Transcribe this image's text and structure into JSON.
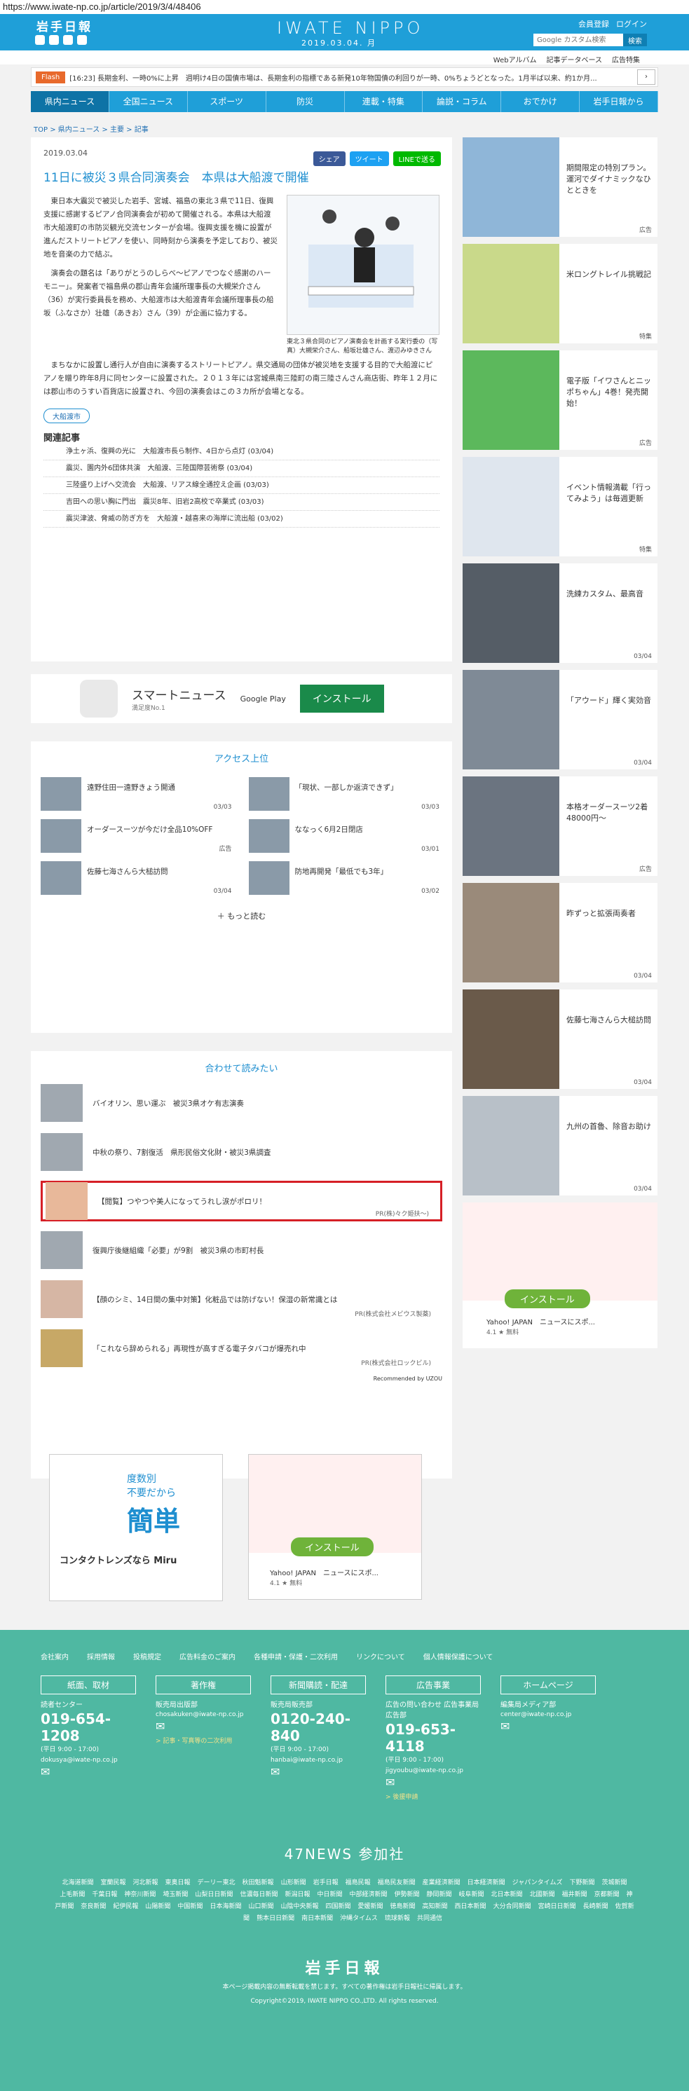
{
  "url": "https://www.iwate-np.co.jp/article/2019/3/4/48406",
  "header": {
    "logo": "岩手日報",
    "brand": "IWATE NIPPO",
    "date": "2019.03.04. 月",
    "links": [
      "会員登録",
      "ログイン"
    ],
    "search_placeholder": "Google カスタム検索",
    "search_button": "検索"
  },
  "subnav": [
    "Webアルバム",
    "記事データベース",
    "広告特集"
  ],
  "flash": {
    "tag": "Flash",
    "text": "[16:23] 長期金利、一時0%に上昇　週明け4日の国債市場は、長期金利の指標である新発10年物国債の利回りが一時、0%ちょうどとなった。1月半ば以来、約1か月..."
  },
  "gnav": [
    "県内ニュース",
    "全国ニュース",
    "スポーツ",
    "防災",
    "連載・特集",
    "論説・コラム",
    "おでかけ",
    "岩手日報から"
  ],
  "crumb": "TOP > 県内ニュース > 主要 > 記事",
  "article": {
    "date": "2019.03.04",
    "share": [
      "シェア",
      "ツイート",
      "LINEで送る"
    ],
    "title": "11日に被災３県合同演奏会　本県は大船渡で開催",
    "p1": "東日本大震災で被災した岩手、宮城、福島の東北３県で11日、復興支援に感謝するピアノ合同演奏会が初めて開催される。本県は大船渡市大船渡町の市防災観光交流センターが会場。復興支援を機に設置が進んだストリートピアノを使い、同時刻から演奏を予定しており、被災地を音楽の力で結ぶ。",
    "p2": "演奏会の題名は「ありがとうのしらべ〜ピアノでつなぐ感謝のハーモニー」。発案者で福島県の郡山青年会議所理事長の大槻栄介さん（36）が実行委員長を務め、大船渡市は大船渡青年会議所理事長の船坂（ふなさか）壮雄（あきお）さん（39）が企画に協力する。",
    "p3": "まちなかに設置し通行人が自由に演奏するストリートピアノ。県交通局の団体が被災地を支援する目的で大船渡にピアノを贈り昨年8月に同センターに設置された。２０１３年には宮城県南三陸町の南三陸さんさん商店街、昨年１２月には郡山市のうすい百貨店に設置され、今回の演奏会はこの３カ所が会場となる。",
    "caption": "東北３県合同のピアノ演奏会を計画する実行委の（写真）大槻栄介さん、船坂壮雄さん、渡辺みゆきさん",
    "tag": "大船渡市",
    "related_title": "関連記事",
    "related": [
      "浄土ヶ浜、復興の光に　大船渡市長ら制作、4日から点灯 (03/04)",
      "震災、園内外6団体共演　大船渡、三陸国際芸術祭 (03/04)",
      "三陸盛り上げへ交流会　大船渡、リアス線全通控え企画 (03/03)",
      "吉田への思い胸に門出　震災8年、旧岩2高校で卒業式 (03/03)",
      "震災津波、脅威の防ぎ方を　大船渡・越喜来の海岸に流出船 (03/02)"
    ]
  },
  "ad1": {
    "name": "スマートニュース",
    "sub": "満足度No.1",
    "store": "Google Play",
    "install": "インストール"
  },
  "access": {
    "title": "アクセス上位",
    "items": [
      {
        "t": "遠野住田一遠野きょう開通",
        "d": "03/03"
      },
      {
        "t": "「現状、一部しか返済できず」",
        "d": "03/03"
      },
      {
        "t": "オーダースーツが今だけ全品10%OFF",
        "d": "広告"
      },
      {
        "t": "ななっく6月2日閉店",
        "d": "03/01"
      },
      {
        "t": "佐藤七海さんら大槌訪問",
        "d": "03/04"
      },
      {
        "t": "防地再開発「最低でも3年」",
        "d": "03/02"
      }
    ],
    "more": "もっと読む"
  },
  "recommend": {
    "title": "合わせて読みたい",
    "items": [
      {
        "t": "バイオリン、思い運ぶ　被災3県オケ有志演奏",
        "pr": ""
      },
      {
        "t": "中秋の祭り、7割復活　県形民俗文化財・被災3県調査",
        "pr": ""
      },
      {
        "t": "【閲覧】つやつや美人になってうれし涙がポロリ！",
        "pr": "PR(株)々ク姫扶～)"
      },
      {
        "t": "復興庁後継組織「必要」が9割　被災3県の市町村長",
        "pr": ""
      },
      {
        "t": "【顔のシミ、14日間の集中対策】化粧品では防げない！保湿の新常識とは",
        "pr": "PR(株式会社メビウス製薬)"
      },
      {
        "t": "「これなら辞められる」再現性が高すぎる電子タバコが爆売れ中",
        "pr": "PR(株式会社ロックビル)"
      }
    ],
    "footer": "Recommended by UZOU"
  },
  "side": [
    {
      "t": "期間限定の特別プラン。運河でダイナミックなひとときを",
      "m": "広告"
    },
    {
      "t": "米ロングトレイル挑戦記",
      "m": "特集"
    },
    {
      "t": "電子版「イワさんとニッポちゃん」4巻！発売開始！",
      "m": "広告"
    },
    {
      "t": "イベント情報満載「行ってみよう」は毎週更新",
      "m": "特集"
    },
    {
      "t": "洗練カスタム、最高音",
      "m": "03/04"
    },
    {
      "t": "「アウード」輝く実効音",
      "m": "03/04"
    },
    {
      "t": "本格オーダースーツ2着48000円〜",
      "m": "広告"
    },
    {
      "t": "昨ずっと拡張両奏者",
      "m": "03/04"
    },
    {
      "t": "佐藤七海さんら大槌訪問",
      "m": "03/04"
    },
    {
      "t": "九州の首魯、除音お助け",
      "m": "03/04"
    }
  ],
  "yahoo_ad": {
    "app": "Yahoo! JAPAN　ニュースにスポ...",
    "rating": "4.1 ★ 無料",
    "install": "インストール"
  },
  "miru_ad": {
    "l1": "度数別",
    "l2": "不要だから",
    "big": "簡単",
    "b": "コンタクトレンズなら Miru"
  },
  "footer": {
    "links": [
      "会社案内",
      "採用情報",
      "投稿規定",
      "広告料金のご案内",
      "各種申請・保護・二次利用",
      "リンクについて",
      "個人情報保護について"
    ],
    "cols": [
      {
        "h": "紙面、取材",
        "s": "読者センター",
        "tel": "019-654-1208",
        "sm": "(平日 9:00 - 17:00)",
        "mail": "dokusya@iwate-np.co.jp",
        "y": ""
      },
      {
        "h": "著作権",
        "s": "販売局出版部",
        "tel": "",
        "sm": "chosakuken@iwate-np.co.jp",
        "mail": "",
        "y": "> 記事・写真等の二次利用"
      },
      {
        "h": "新聞購読・配達",
        "s": "販売局販売部",
        "tel": "0120-240-840",
        "sm": "(平日 9:00 - 17:00)",
        "mail": "hanbai@iwate-np.co.jp",
        "y": ""
      },
      {
        "h": "広告事業",
        "s": "広告の問い合わせ 広告事業局広告部",
        "tel": "019-653-4118",
        "sm": "(平日 9:00 - 17:00)",
        "mail": "jigyoubu@iwate-np.co.jp",
        "y": "> 後援申請"
      },
      {
        "h": "ホームページ",
        "s": "編集局メディア部",
        "tel": "",
        "sm": "center@iwate-np.co.jp",
        "mail": "",
        "y": ""
      }
    ],
    "n47": "47NEWS 参加社",
    "papers": [
      "北海道新聞",
      "室蘭民報",
      "河北新報",
      "東奥日報",
      "デーリー東北",
      "秋田魁新報",
      "山形新聞",
      "岩手日報",
      "福島民報",
      "福島民友新聞",
      "産業経済新聞",
      "日本経済新聞",
      "ジャパンタイムズ",
      "下野新聞",
      "茨城新聞",
      "上毛新聞",
      "千葉日報",
      "神奈川新聞",
      "埼玉新聞",
      "山梨日日新聞",
      "信濃毎日新聞",
      "新潟日報",
      "中日新聞",
      "中部経済新聞",
      "伊勢新聞",
      "静岡新聞",
      "岐阜新聞",
      "北日本新聞",
      "北國新聞",
      "福井新聞",
      "京都新聞",
      "神戸新聞",
      "奈良新聞",
      "紀伊民報",
      "山陽新聞",
      "中国新聞",
      "日本海新聞",
      "山口新聞",
      "山陰中央新報",
      "四国新聞",
      "愛媛新聞",
      "徳島新聞",
      "高知新聞",
      "西日本新聞",
      "大分合同新聞",
      "宮崎日日新聞",
      "長崎新聞",
      "佐賀新聞",
      "熊本日日新聞",
      "南日本新聞",
      "沖縄タイムス",
      "琉球新報",
      "共同通信"
    ],
    "logo": "岩手日報",
    "note": "本ページ掲載内容の無断転載を禁じます。すべての著作権は岩手日報社に帰属します。",
    "copy": "Copyright©2019, IWATE NIPPO CO.,LTD. All rights reserved."
  }
}
